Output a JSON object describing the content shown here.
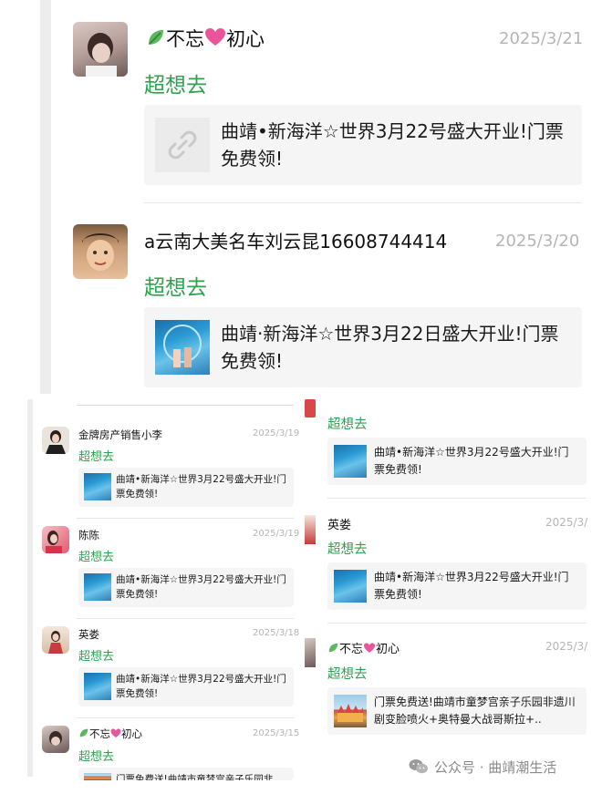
{
  "top": {
    "posts": [
      {
        "name": "不忘",
        "name_suffix": "初心",
        "date": "2025/3/21",
        "comment": "超想去",
        "card": "曲靖•新海洋☆世界3月22号盛大开业!门票免费领!"
      },
      {
        "name": "a云南大美名车刘云昆16608744414",
        "date": "2025/3/20",
        "comment": "超想去",
        "card": "曲靖·新海洋☆世界3月22日盛大开业!门票免费领!"
      }
    ]
  },
  "left": {
    "posts": [
      {
        "name": "金牌房产销售小李",
        "date": "2025/3/19",
        "comment": "超想去",
        "card": "曲靖•新海洋☆世界3月22号盛大开业!门票免费领!"
      },
      {
        "name": "陈陈",
        "date": "2025/3/19",
        "comment": "超想去",
        "card": "曲靖•新海洋☆世界3月22号盛大开业!门票免费领!"
      },
      {
        "name": "英娄",
        "date": "2025/3/18",
        "comment": "超想去",
        "card": "曲靖•新海洋☆世界3月22号盛大开业!门票免费领!"
      },
      {
        "name": "不忘",
        "name_suffix": "初心",
        "date": "2025/3/15",
        "comment": "超想去",
        "card": "门票免费送!曲靖市童梦宫亲子乐园非"
      }
    ]
  },
  "right": {
    "posts": [
      {
        "comment": "超想去",
        "card": "曲靖•新海洋☆世界3月22号盛大开业!门票免费领!"
      },
      {
        "name": "英娄",
        "date": "2025/3/",
        "comment": "超想去",
        "card": "曲靖•新海洋☆世界3月22号盛大开业!门票免费领!"
      },
      {
        "name": "不忘",
        "name_suffix": "初心",
        "date": "2025/3/",
        "comment": "超想去",
        "card": "门票免费送!曲靖市童梦宫亲子乐园非遗川剧变脸喷火+奥特曼大战哥斯拉+.."
      }
    ]
  },
  "watermark": {
    "text": "公众号 · 曲靖潮生活"
  },
  "colors": {
    "comment": "#2fa24f",
    "date": "#b5b5b5",
    "card_bg": "#f5f5f5"
  }
}
